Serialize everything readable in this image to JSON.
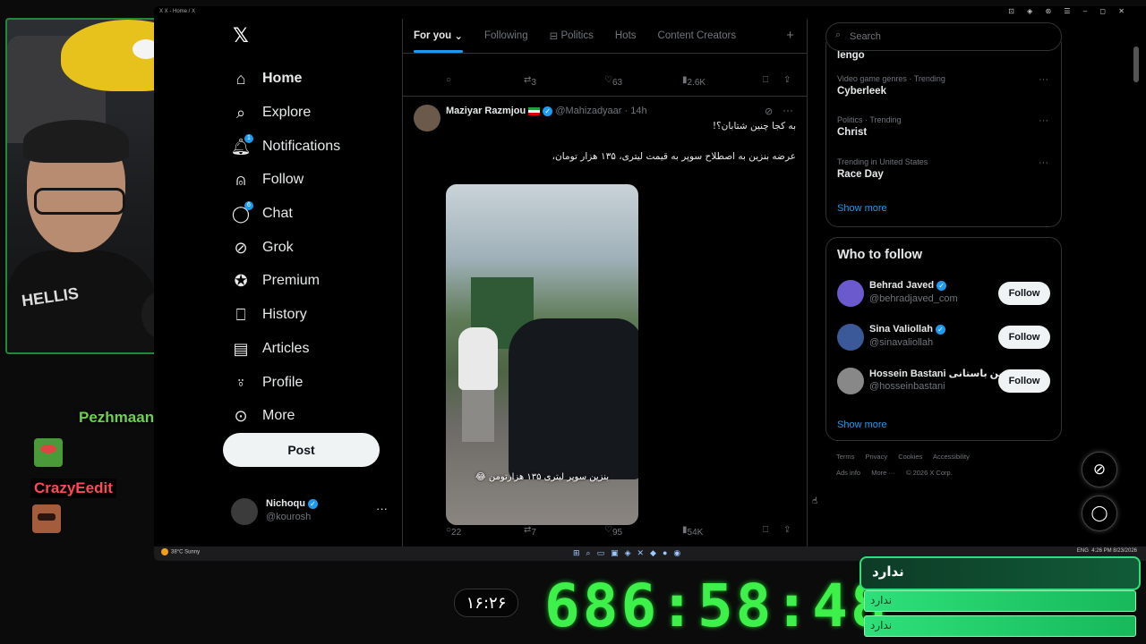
{
  "window": {
    "title": "X  X - Home / X",
    "controls": "⊡ ◈ ⊛ ☰ – ◻ ✕"
  },
  "nav": {
    "items": [
      {
        "label": "Home",
        "icon": "home-icon"
      },
      {
        "label": "Explore",
        "icon": "search-icon"
      },
      {
        "label": "Notifications",
        "icon": "bell-icon",
        "badge": "1"
      },
      {
        "label": "Follow",
        "icon": "add-person-icon"
      },
      {
        "label": "Chat",
        "icon": "chat-icon",
        "badge": "6"
      },
      {
        "label": "Grok",
        "icon": "grok-icon"
      },
      {
        "label": "Premium",
        "icon": "verified-icon"
      },
      {
        "label": "History",
        "icon": "bookmark-icon"
      },
      {
        "label": "Articles",
        "icon": "articles-icon"
      },
      {
        "label": "Profile",
        "icon": "person-icon"
      },
      {
        "label": "More",
        "icon": "more-circle-icon"
      }
    ],
    "post_label": "Post"
  },
  "account": {
    "name": "Nichoqu",
    "handle": "@kourosh"
  },
  "tabs": [
    "For you",
    "Following",
    "Politics",
    "Hots",
    "Content Creators"
  ],
  "prev_actions": {
    "replies": "",
    "reposts": "3",
    "likes": "63",
    "views": "2.6K"
  },
  "tweet": {
    "name": "Maziyar Razmjou",
    "handle": "@Mahizadyaar",
    "time": "· 14h",
    "text1": "به کجا چنین شتابان؟!",
    "text2": "عرضه بنزین به اصطلاح سوپر به قیمت لیتری، ۱۳۵ هزار تومان،",
    "media_caption": "بنزین سوپر لیتری ۱۳۵ هزارتومن 😂",
    "replies": "22",
    "reposts": "7",
    "likes": "95",
    "views": "54K"
  },
  "search": {
    "placeholder": "Search"
  },
  "trends": {
    "partial": "lengo",
    "items": [
      {
        "meta": "Video game genres · Trending",
        "name": "Cyberleek"
      },
      {
        "meta": "Politics · Trending",
        "name": "Christ"
      },
      {
        "meta": "Trending in United States",
        "name": "Race Day"
      }
    ],
    "show_more": "Show more"
  },
  "who_to_follow": {
    "title": "Who to follow",
    "users": [
      {
        "name": "Behrad Javed",
        "handle": "@behradjaved_com",
        "button": "Follow",
        "color": "#6a5acd"
      },
      {
        "name": "Sina Valiollah",
        "handle": "@sinavaliollah",
        "button": "Follow",
        "color": "#3b5998"
      },
      {
        "name": "Hossein Bastani حسین باستانی",
        "handle": "@hosseinbastani",
        "button": "Follow",
        "color": "#888888"
      }
    ],
    "show_more": "Show more"
  },
  "footer": {
    "links": [
      "Terms",
      "Privacy",
      "Cookies",
      "Accessibility",
      "Ads info",
      "More ···"
    ],
    "copyright": "© 2026 X Corp."
  },
  "taskbar": {
    "weather_temp": "38°C",
    "weather_text": "Sunny",
    "tray_lang": "ENG",
    "tray_time": "4:26 PM",
    "tray_date": "8/23/2026"
  },
  "stream": {
    "chat_user1": "Pezhmaan",
    "chat_user2": "CrazyEedit",
    "clock": "۱۶:۲۶",
    "timer": "686:58:48",
    "panel_title": "ندارد",
    "bar1": "ندارد",
    "bar2": "ندارد"
  },
  "colors": {
    "accent": "#1d9bf0",
    "timer_green": "#3ef04a",
    "panel_green": "#2ee07a"
  }
}
